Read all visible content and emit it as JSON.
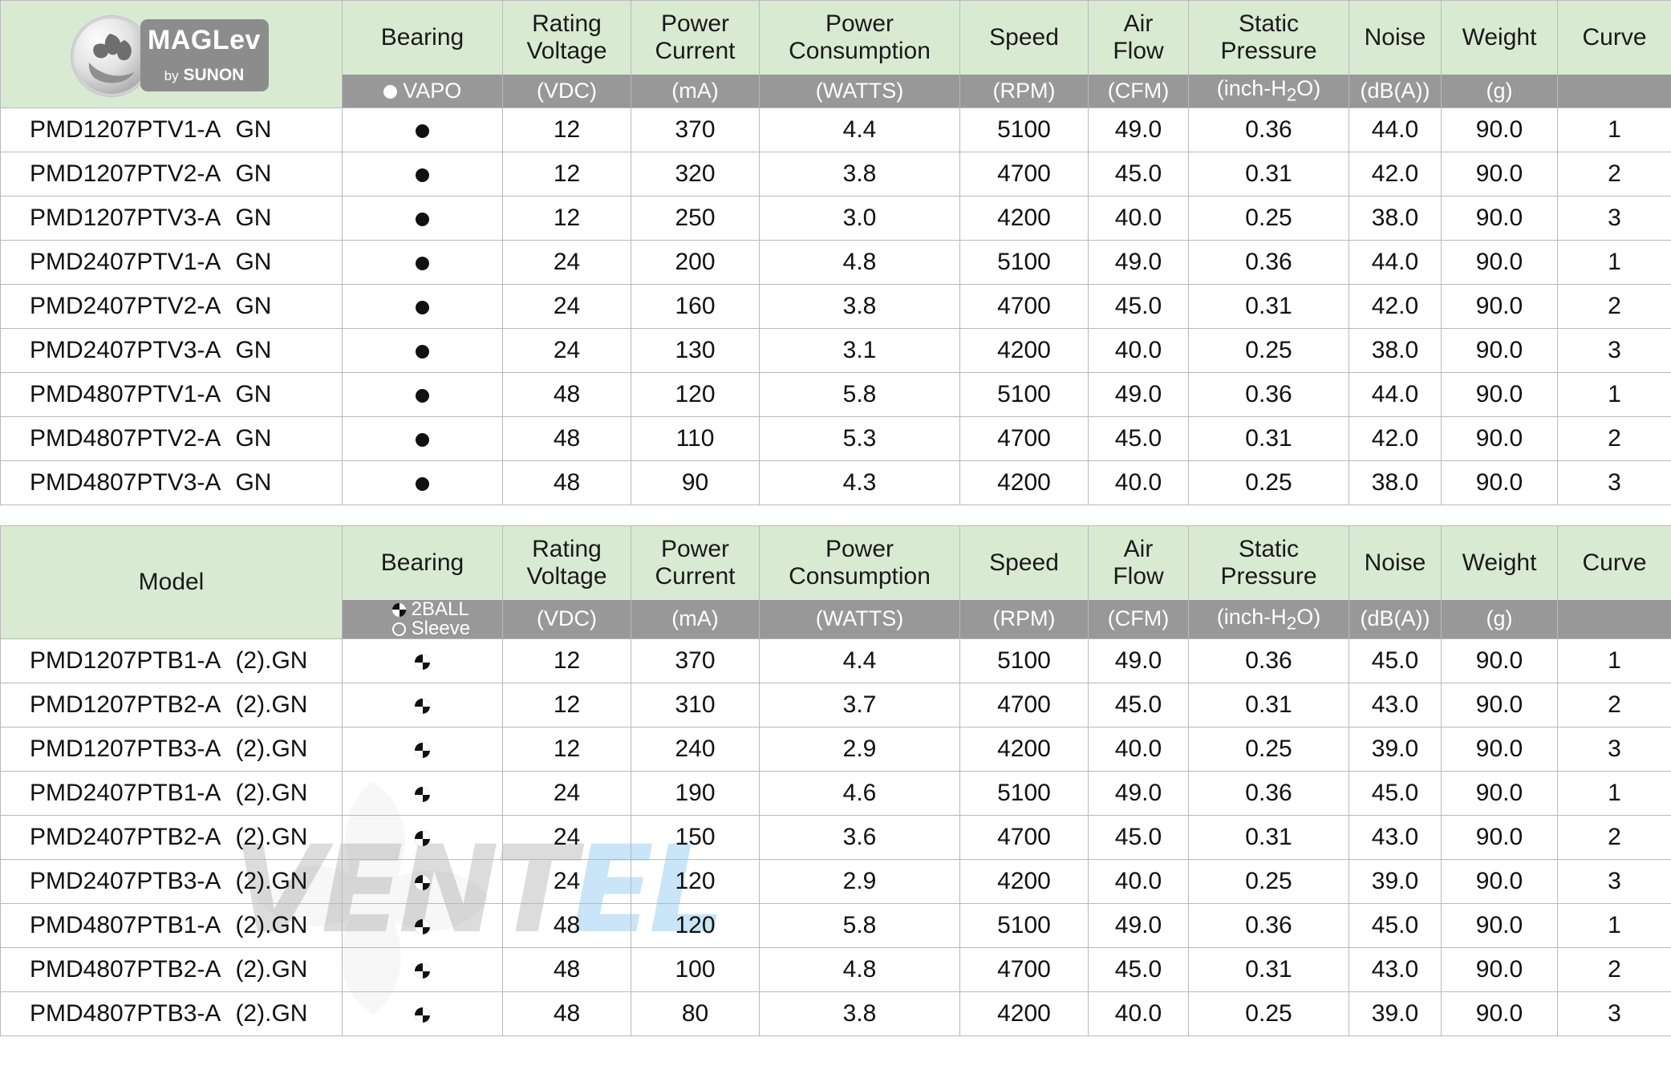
{
  "brand": {
    "logo_title": "MAGLev",
    "logo_sub_by": "by",
    "logo_sub_name": "SUNON"
  },
  "watermark": {
    "text_a": "VENT",
    "text_b": "EL"
  },
  "colors": {
    "header_green": "#d9ead3",
    "unit_gray": "#989898",
    "grid": "#b9b9b9",
    "text": "#111111"
  },
  "columns": {
    "model": "Model",
    "bearing": "Bearing",
    "rating_voltage": "Rating\nVoltage",
    "rating_voltage_l1": "Rating",
    "rating_voltage_l2": "Voltage",
    "power_current_l1": "Power",
    "power_current_l2": "Current",
    "power_consumption_l1": "Power",
    "power_consumption_l2": "Consumption",
    "speed": "Speed",
    "air_flow_l1": "Air",
    "air_flow_l2": "Flow",
    "static_pressure_l1": "Static",
    "static_pressure_l2": "Pressure",
    "noise": "Noise",
    "weight": "Weight",
    "curve": "Curve"
  },
  "units": {
    "bearing_vapo": "VAPO",
    "bearing_2ball": "2BALL",
    "bearing_sleeve": "Sleeve",
    "voltage": "(VDC)",
    "current": "(mA)",
    "consumption": "(WATTS)",
    "speed": "(RPM)",
    "air_flow": "(CFM)",
    "static_pressure_pre": "(inch-H",
    "static_pressure_sub": "2",
    "static_pressure_post": "O)",
    "noise": "(dB(A))",
    "weight": "(g)",
    "curve": ""
  },
  "table1": {
    "bearing_symbol": "vapo",
    "rows": [
      {
        "model": "PMD1207PTV1-A",
        "suffix": "GN",
        "suffix2": "",
        "bearing": "vapo",
        "voltage": "12",
        "current": "370",
        "consumption": "4.4",
        "speed": "5100",
        "air_flow": "49.0",
        "static_pressure": "0.36",
        "noise": "44.0",
        "weight": "90.0",
        "curve": "1"
      },
      {
        "model": "PMD1207PTV2-A",
        "suffix": "GN",
        "suffix2": "",
        "bearing": "vapo",
        "voltage": "12",
        "current": "320",
        "consumption": "3.8",
        "speed": "4700",
        "air_flow": "45.0",
        "static_pressure": "0.31",
        "noise": "42.0",
        "weight": "90.0",
        "curve": "2"
      },
      {
        "model": "PMD1207PTV3-A",
        "suffix": "GN",
        "suffix2": "",
        "bearing": "vapo",
        "voltage": "12",
        "current": "250",
        "consumption": "3.0",
        "speed": "4200",
        "air_flow": "40.0",
        "static_pressure": "0.25",
        "noise": "38.0",
        "weight": "90.0",
        "curve": "3"
      },
      {
        "model": "PMD2407PTV1-A",
        "suffix": "GN",
        "suffix2": "",
        "bearing": "vapo",
        "voltage": "24",
        "current": "200",
        "consumption": "4.8",
        "speed": "5100",
        "air_flow": "49.0",
        "static_pressure": "0.36",
        "noise": "44.0",
        "weight": "90.0",
        "curve": "1"
      },
      {
        "model": "PMD2407PTV2-A",
        "suffix": "GN",
        "suffix2": "",
        "bearing": "vapo",
        "voltage": "24",
        "current": "160",
        "consumption": "3.8",
        "speed": "4700",
        "air_flow": "45.0",
        "static_pressure": "0.31",
        "noise": "42.0",
        "weight": "90.0",
        "curve": "2"
      },
      {
        "model": "PMD2407PTV3-A",
        "suffix": "GN",
        "suffix2": "",
        "bearing": "vapo",
        "voltage": "24",
        "current": "130",
        "consumption": "3.1",
        "speed": "4200",
        "air_flow": "40.0",
        "static_pressure": "0.25",
        "noise": "38.0",
        "weight": "90.0",
        "curve": "3"
      },
      {
        "model": "PMD4807PTV1-A",
        "suffix": "GN",
        "suffix2": "",
        "bearing": "vapo",
        "voltage": "48",
        "current": "120",
        "consumption": "5.8",
        "speed": "5100",
        "air_flow": "49.0",
        "static_pressure": "0.36",
        "noise": "44.0",
        "weight": "90.0",
        "curve": "1"
      },
      {
        "model": "PMD4807PTV2-A",
        "suffix": "GN",
        "suffix2": "",
        "bearing": "vapo",
        "voltage": "48",
        "current": "110",
        "consumption": "5.3",
        "speed": "4700",
        "air_flow": "45.0",
        "static_pressure": "0.31",
        "noise": "42.0",
        "weight": "90.0",
        "curve": "2"
      },
      {
        "model": "PMD4807PTV3-A",
        "suffix": "GN",
        "suffix2": "",
        "bearing": "vapo",
        "voltage": "48",
        "current": "90",
        "consumption": "4.3",
        "speed": "4200",
        "air_flow": "40.0",
        "static_pressure": "0.25",
        "noise": "38.0",
        "weight": "90.0",
        "curve": "3"
      }
    ]
  },
  "table2": {
    "bearing_symbol": "2ball",
    "rows": [
      {
        "model": "PMD1207PTB1-A",
        "suffix": "(2).GN",
        "suffix2": "",
        "bearing": "2ball",
        "voltage": "12",
        "current": "370",
        "consumption": "4.4",
        "speed": "5100",
        "air_flow": "49.0",
        "static_pressure": "0.36",
        "noise": "45.0",
        "weight": "90.0",
        "curve": "1"
      },
      {
        "model": "PMD1207PTB2-A",
        "suffix": "(2).GN",
        "suffix2": "",
        "bearing": "2ball",
        "voltage": "12",
        "current": "310",
        "consumption": "3.7",
        "speed": "4700",
        "air_flow": "45.0",
        "static_pressure": "0.31",
        "noise": "43.0",
        "weight": "90.0",
        "curve": "2"
      },
      {
        "model": "PMD1207PTB3-A",
        "suffix": "(2).GN",
        "suffix2": "",
        "bearing": "2ball",
        "voltage": "12",
        "current": "240",
        "consumption": "2.9",
        "speed": "4200",
        "air_flow": "40.0",
        "static_pressure": "0.25",
        "noise": "39.0",
        "weight": "90.0",
        "curve": "3"
      },
      {
        "model": "PMD2407PTB1-A",
        "suffix": "(2).GN",
        "suffix2": "",
        "bearing": "2ball",
        "voltage": "24",
        "current": "190",
        "consumption": "4.6",
        "speed": "5100",
        "air_flow": "49.0",
        "static_pressure": "0.36",
        "noise": "45.0",
        "weight": "90.0",
        "curve": "1"
      },
      {
        "model": "PMD2407PTB2-A",
        "suffix": "(2).GN",
        "suffix2": "",
        "bearing": "2ball",
        "voltage": "24",
        "current": "150",
        "consumption": "3.6",
        "speed": "4700",
        "air_flow": "45.0",
        "static_pressure": "0.31",
        "noise": "43.0",
        "weight": "90.0",
        "curve": "2"
      },
      {
        "model": "PMD2407PTB3-A",
        "suffix": "(2).GN",
        "suffix2": "",
        "bearing": "2ball",
        "voltage": "24",
        "current": "120",
        "consumption": "2.9",
        "speed": "4200",
        "air_flow": "40.0",
        "static_pressure": "0.25",
        "noise": "39.0",
        "weight": "90.0",
        "curve": "3"
      },
      {
        "model": "PMD4807PTB1-A",
        "suffix": "(2).GN",
        "suffix2": "",
        "bearing": "2ball",
        "voltage": "48",
        "current": "120",
        "consumption": "5.8",
        "speed": "5100",
        "air_flow": "49.0",
        "static_pressure": "0.36",
        "noise": "45.0",
        "weight": "90.0",
        "curve": "1"
      },
      {
        "model": "PMD4807PTB2-A",
        "suffix": "(2).GN",
        "suffix2": "",
        "bearing": "2ball",
        "voltage": "48",
        "current": "100",
        "consumption": "4.8",
        "speed": "4700",
        "air_flow": "45.0",
        "static_pressure": "0.31",
        "noise": "43.0",
        "weight": "90.0",
        "curve": "2"
      },
      {
        "model": "PMD4807PTB3-A",
        "suffix": "(2).GN",
        "suffix2": "",
        "bearing": "2ball",
        "voltage": "48",
        "current": "80",
        "consumption": "3.8",
        "speed": "4200",
        "air_flow": "40.0",
        "static_pressure": "0.25",
        "noise": "39.0",
        "weight": "90.0",
        "curve": "3"
      }
    ]
  }
}
